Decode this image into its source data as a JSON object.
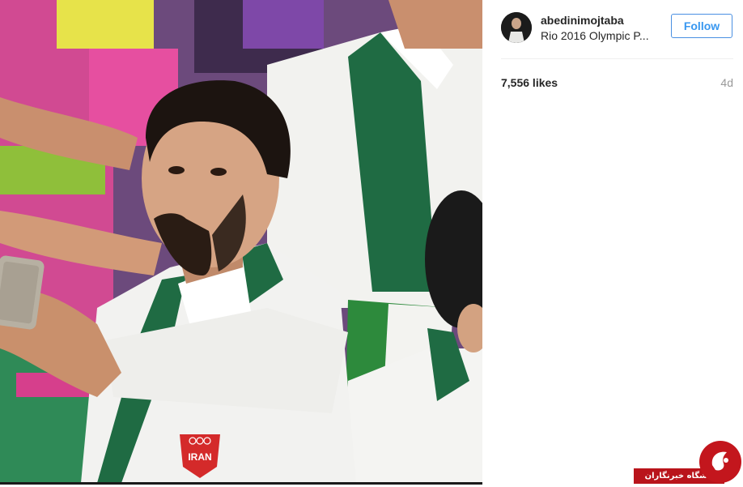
{
  "post": {
    "username": "abedinimojtaba",
    "location": "Rio 2016 Olympic P...",
    "follow_label": "Follow",
    "likes": "7,556 likes",
    "time_ago": "4d"
  },
  "photo": {
    "jacket_badge_text": "IRAN"
  },
  "watermark": {
    "text": "باشگاه خبرنگاران"
  },
  "icons": [
    "profile-avatar",
    "olympic-rings-icon",
    "watermark-logo-icon"
  ],
  "colors": {
    "follow_blue": "#3897f0",
    "watermark_red": "#b9141b",
    "jacket_white": "#f2f2f0",
    "collar_green": "#1f6b43"
  }
}
